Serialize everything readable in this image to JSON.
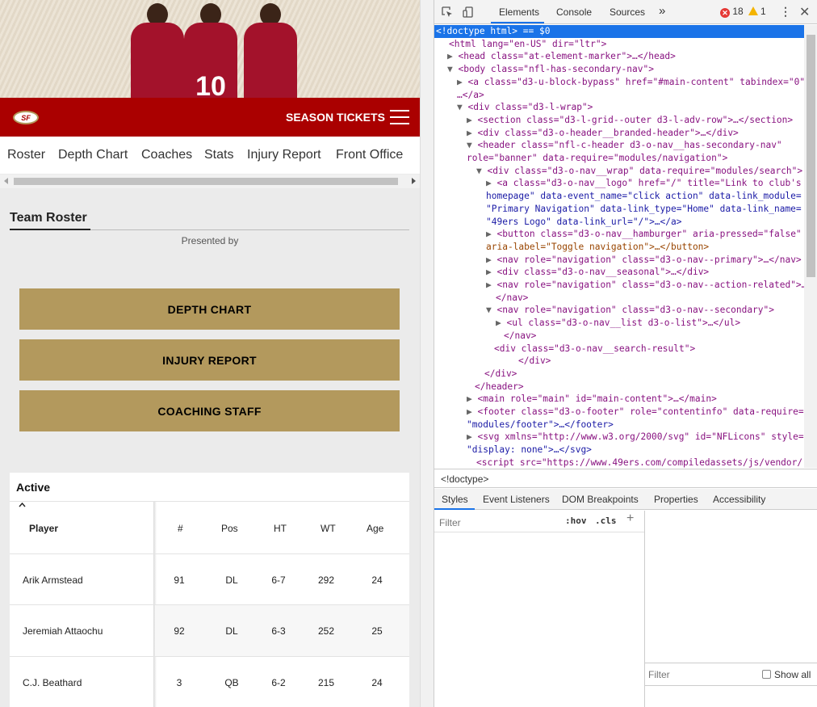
{
  "site": {
    "header": {
      "logo_text": "SF",
      "season_tickets": "SEASON TICKETS",
      "menu_icon": "hamburger-icon",
      "hero_jersey_number": "10"
    },
    "subnav": [
      "Roster",
      "Depth Chart",
      "Coaches",
      "Stats",
      "Injury Report",
      "Front Office"
    ],
    "team_roster_title": "Team Roster",
    "presented_by": "Presented by",
    "buttons": {
      "depth_chart": "DEPTH CHART",
      "injury_report": "INJURY REPORT",
      "coaching_staff": "COACHING STAFF"
    },
    "table": {
      "section_title": "Active",
      "headers": [
        "Player",
        "#",
        "Pos",
        "HT",
        "WT",
        "Age"
      ],
      "rows": [
        {
          "player": "Arik Armstead",
          "num": "91",
          "pos": "DL",
          "ht": "6-7",
          "wt": "292",
          "age": "24"
        },
        {
          "player": "Jeremiah Attaochu",
          "num": "92",
          "pos": "DL",
          "ht": "6-3",
          "wt": "252",
          "age": "25"
        },
        {
          "player": "C.J. Beathard",
          "num": "3",
          "pos": "QB",
          "ht": "6-2",
          "wt": "215",
          "age": "24"
        }
      ]
    },
    "colors": {
      "red": "#aa0000",
      "gold": "#b3995d"
    }
  },
  "devtools": {
    "tabs": [
      "Elements",
      "Console",
      "Sources"
    ],
    "more_tabs": "»",
    "errors": "18",
    "warnings": "1",
    "breadcrumb": "<!doctype>",
    "subtabs": [
      "Styles",
      "Event Listeners",
      "DOM Breakpoints",
      "Properties",
      "Accessibility"
    ],
    "filter_placeholder": "Filter",
    "hov": ":hov",
    "cls": ".cls",
    "computed_filter": "Filter",
    "show_all": "Show all",
    "dom_lines": [
      "<!doctype html> == $0",
      "<html lang=\"en-US\" dir=\"ltr\">",
      "<head class=\"at-element-marker\">…</head>",
      "<body class=\"nfl-has-secondary-nav\">",
      "<a class=\"d3-u-block-bypass\" href=\"#main-content\" tabindex=\"0\">",
      "…</a>",
      "<div class=\"d3-l-wrap\">",
      "<section class=\"d3-l-grid--outer d3-l-adv-row\">…</section>",
      "<div class=\"d3-o-header__branded-header\">…</div>",
      "<header class=\"nfl-c-header d3-o-nav__has-secondary-nav\"",
      "role=\"banner\" data-require=\"modules/navigation\">",
      "<div class=\"d3-o-nav__wrap\" data-require=\"modules/search\">",
      "<a class=\"d3-o-nav__logo\" href=\"/\" title=\"Link to club's",
      "homepage\" data-event_name=\"click action\" data-link_module=",
      "\"Primary Navigation\" data-link_type=\"Home\" data-link_name=",
      "\"49ers Logo\" data-link_url=\"/\">…</a>",
      "<button class=\"d3-o-nav__hamburger\" aria-pressed=\"false\"",
      "aria-label=\"Toggle navigation\">…</button>",
      "<nav role=\"navigation\" class=\"d3-o-nav--primary\">…</nav>",
      "<div class=\"d3-o-nav__seasonal\">…</div>",
      "<nav role=\"navigation\" class=\"d3-o-nav--action-related\">…",
      "</nav>",
      "<nav role=\"navigation\" class=\"d3-o-nav--secondary\">",
      "<ul class=\"d3-o-nav__list d3-o-list\">…</ul>",
      "</nav>",
      "<div class=\"d3-o-nav__search-result\">",
      "</div>",
      "</div>",
      "</header>",
      "<main role=\"main\" id=\"main-content\">…</main>",
      "<footer class=\"d3-o-footer\" role=\"contentinfo\" data-require=",
      "\"modules/footer\">…</footer>",
      "<svg xmlns=\"http://www.w3.org/2000/svg\" id=\"NFLicons\" style=",
      "\"display: none\">…</svg>",
      "<script src=\"https://www.49ers.com/compiledassets/js/vendor/"
    ]
  }
}
